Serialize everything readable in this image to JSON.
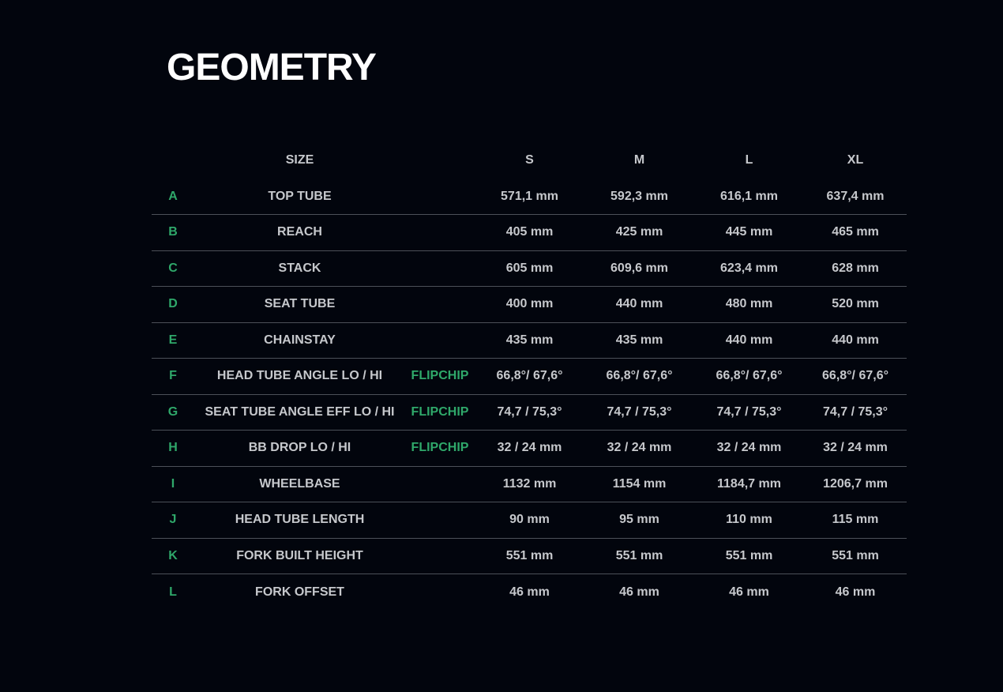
{
  "title": "GEOMETRY",
  "header": {
    "size_label": "SIZE",
    "sizes": [
      "S",
      "M",
      "L",
      "XL"
    ]
  },
  "accent_color": "#2fa86a",
  "rows": [
    {
      "letter": "A",
      "name": "TOP TUBE",
      "flip": "",
      "values": [
        "571,1 mm",
        "592,3 mm",
        "616,1 mm",
        "637,4 mm"
      ]
    },
    {
      "letter": "B",
      "name": "REACH",
      "flip": "",
      "values": [
        "405 mm",
        "425 mm",
        "445 mm",
        "465 mm"
      ]
    },
    {
      "letter": "C",
      "name": "STACK",
      "flip": "",
      "values": [
        "605 mm",
        "609,6 mm",
        "623,4 mm",
        "628 mm"
      ]
    },
    {
      "letter": "D",
      "name": "SEAT TUBE",
      "flip": "",
      "values": [
        "400 mm",
        "440 mm",
        "480 mm",
        "520 mm"
      ]
    },
    {
      "letter": "E",
      "name": "CHAINSTAY",
      "flip": "",
      "values": [
        "435 mm",
        "435 mm",
        "440 mm",
        "440 mm"
      ]
    },
    {
      "letter": "F",
      "name": "HEAD TUBE ANGLE  LO / HI",
      "flip": "FLIPCHIP",
      "values": [
        "66,8°/ 67,6°",
        "66,8°/ 67,6°",
        "66,8°/ 67,6°",
        "66,8°/ 67,6°"
      ]
    },
    {
      "letter": "G",
      "name": "SEAT TUBE ANGLE EFF  LO / HI",
      "flip": "FLIPCHIP",
      "values": [
        "74,7 / 75,3°",
        "74,7 / 75,3°",
        "74,7 / 75,3°",
        "74,7 / 75,3°"
      ]
    },
    {
      "letter": "H",
      "name": "BB DROP  LO / HI",
      "flip": "FLIPCHIP",
      "values": [
        "32 / 24 mm",
        "32 / 24 mm",
        "32 / 24 mm",
        "32 / 24 mm"
      ]
    },
    {
      "letter": "I",
      "name": "WHEELBASE",
      "flip": "",
      "values": [
        "1132 mm",
        "1154 mm",
        "1184,7 mm",
        "1206,7 mm"
      ]
    },
    {
      "letter": "J",
      "name": "HEAD TUBE LENGTH",
      "flip": "",
      "values": [
        "90 mm",
        "95 mm",
        "110 mm",
        "115 mm"
      ]
    },
    {
      "letter": "K",
      "name": "FORK BUILT HEIGHT",
      "flip": "",
      "values": [
        "551 mm",
        "551 mm",
        "551 mm",
        "551 mm"
      ]
    },
    {
      "letter": "L",
      "name": "FORK OFFSET",
      "flip": "",
      "values": [
        "46 mm",
        "46 mm",
        "46 mm",
        "46 mm"
      ]
    }
  ]
}
